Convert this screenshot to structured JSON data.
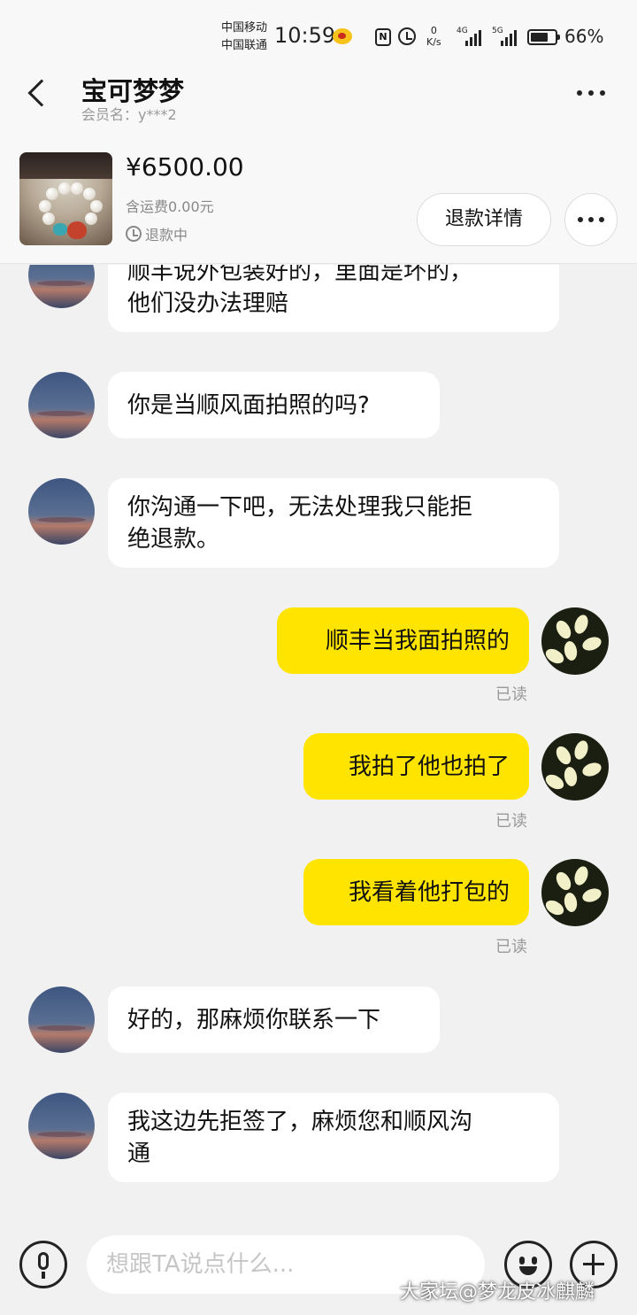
{
  "status_bar": {
    "carrier_1": "中国移动",
    "carrier_2": "中国联通",
    "time": "10:59",
    "net_speed_value": "0",
    "net_speed_unit": "K/s",
    "signal_1_tag": "4G",
    "signal_2_tag": "5G",
    "battery": "66%",
    "icons": [
      "weibo-icon",
      "nfc-icon",
      "alarm-icon",
      "signal-icon",
      "battery-icon"
    ]
  },
  "header": {
    "title": "宝可梦梦",
    "member_label": "会员名：",
    "member_name": "y***2"
  },
  "order": {
    "price": "¥6500.00",
    "shipping": "含运费0.00元",
    "status": "退款中",
    "refund_detail_label": "退款详情"
  },
  "messages": [
    {
      "from": "other",
      "lines": [
        "顺丰说外包装好的，里面是坏的，",
        "他们没办法理赔"
      ]
    },
    {
      "from": "other",
      "lines": [
        "你是当顺风面拍照的吗?"
      ]
    },
    {
      "from": "other",
      "lines": [
        "你沟通一下吧，无法处理我只能拒",
        "绝退款。"
      ]
    },
    {
      "from": "self",
      "lines": [
        "顺丰当我面拍照的"
      ],
      "read": "已读"
    },
    {
      "from": "self",
      "lines": [
        "我拍了他也拍了"
      ],
      "read": "已读"
    },
    {
      "from": "self",
      "lines": [
        "我看着他打包的"
      ],
      "read": "已读"
    },
    {
      "from": "other",
      "lines": [
        "好的，那麻烦你联系一下"
      ]
    },
    {
      "from": "other",
      "lines": [
        "我这边先拒签了，麻烦您和顺风沟",
        "通"
      ]
    }
  ],
  "input": {
    "placeholder": "想跟TA说点什么..."
  },
  "watermark": "大家坛@梦龙皮冰麒麟",
  "colors": {
    "self_bubble": "#ffe400",
    "other_bubble": "#ffffff",
    "background": "#f1f1f1"
  }
}
